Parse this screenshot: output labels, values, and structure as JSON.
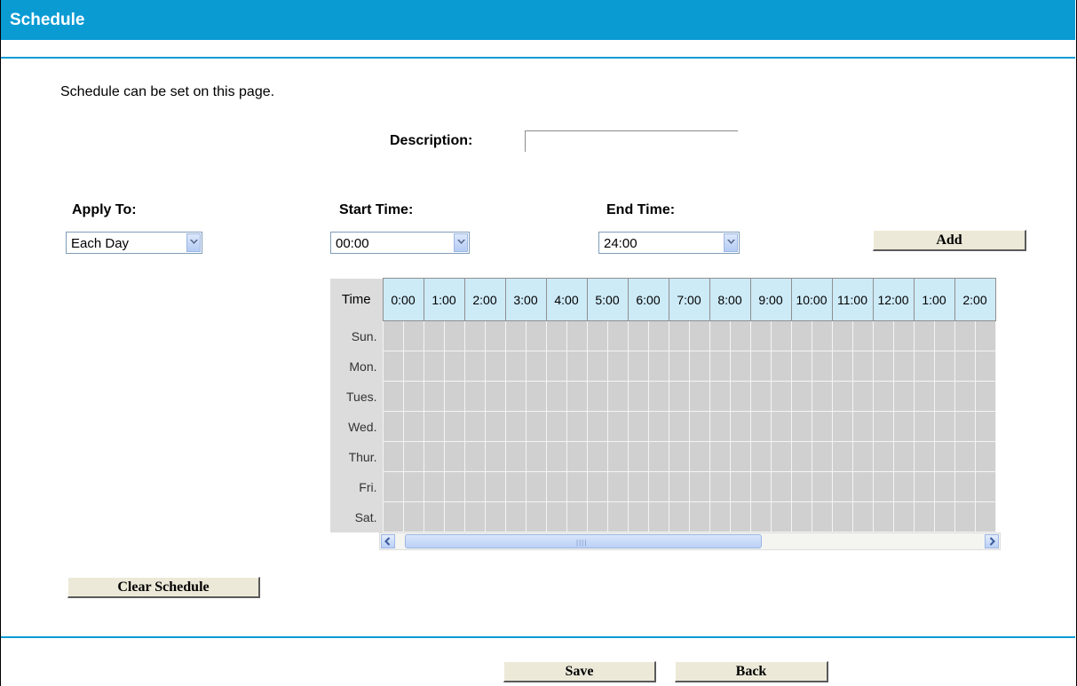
{
  "header": {
    "title": "Schedule"
  },
  "intro": "Schedule can be set on this page.",
  "description": {
    "label": "Description:",
    "value": ""
  },
  "apply_to": {
    "label": "Apply To:",
    "selected": "Each Day"
  },
  "start_time": {
    "label": "Start Time:",
    "selected": "00:00"
  },
  "end_time": {
    "label": "End Time:",
    "selected": "24:00"
  },
  "buttons": {
    "add": "Add",
    "clear": "Clear Schedule",
    "save": "Save",
    "back": "Back"
  },
  "grid": {
    "time_header": "Time",
    "hours": [
      "0:00",
      "1:00",
      "2:00",
      "3:00",
      "4:00",
      "5:00",
      "6:00",
      "7:00",
      "8:00",
      "9:00",
      "10:00",
      "11:00",
      "12:00",
      "1:00",
      "2:00"
    ],
    "days": [
      "Sun.",
      "Mon.",
      "Tues.",
      "Wed.",
      "Thur.",
      "Fri.",
      "Sat."
    ]
  }
}
